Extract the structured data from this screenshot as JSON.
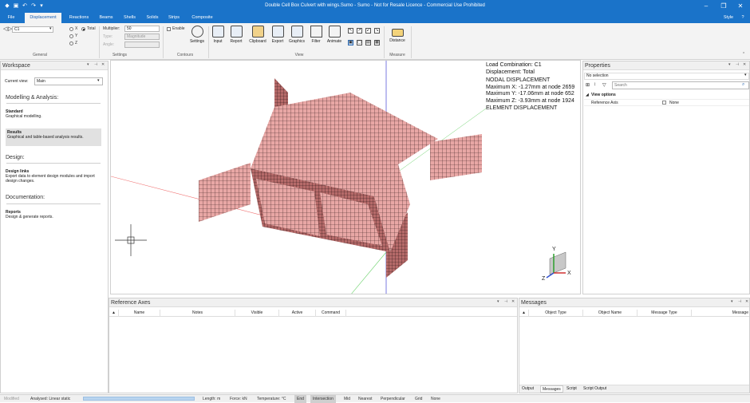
{
  "titlebar": {
    "title": "Double Cell Box Culvert with wings.Sumo - Sumo - Not for Resale Licence - Commercial Use Prohibited"
  },
  "tabs": [
    "File",
    "Displacement",
    "Reactions",
    "Beams",
    "Shells",
    "Solids",
    "Strips",
    "Composite"
  ],
  "style_label": "Style",
  "ribbon": {
    "general": {
      "load_value": "C1",
      "radios": [
        "X",
        "Y",
        "Z"
      ],
      "total_label": "Total",
      "label": "General"
    },
    "settings": {
      "multiplier_label": "Multiplier:",
      "multiplier_value": "50",
      "type_label": "Type:",
      "type_value": "Magnitude",
      "angle_label": "Angle:",
      "label": "Settings"
    },
    "contours": {
      "enable_label": "Enable",
      "settings_label": "Settings",
      "label": "Contours"
    },
    "view": {
      "buttons": [
        "Input",
        "Report",
        "Clipboard",
        "Export",
        "Graphics",
        "Filter",
        "Animate"
      ],
      "label": "View"
    },
    "measure": {
      "distance_label": "Distance",
      "label": "Measure"
    }
  },
  "workspace": {
    "title": "Workspace",
    "current_view_label": "Current view:",
    "current_view_value": "Main",
    "sections": [
      {
        "heading": "Modelling & Analysis:"
      },
      {
        "heading": "Design:"
      },
      {
        "heading": "Documentation:"
      }
    ],
    "items": [
      {
        "title": "Standard",
        "desc": "Graphical modelling."
      },
      {
        "title": "Results",
        "desc": "Graphical and table-based analysis results."
      },
      {
        "title": "Design links",
        "desc": "Export data to element design modules and import design changes."
      },
      {
        "title": "Reports",
        "desc": "Design & generate reports."
      }
    ]
  },
  "viewport": {
    "lines": [
      "Load Combination: C1",
      "Displacement: Total",
      "NODAL DISPLACEMENT",
      "Maximum X: -1.27mm at node 2659",
      "Maximum Y: -17.06mm at node 652",
      "Maximum Z: -3.93mm at node 1924",
      "ELEMENT DISPLACEMENT"
    ],
    "axis_labels": {
      "y": "Y",
      "z": "Z",
      "x": "X"
    },
    "mesh_color": "#e8a7a5",
    "mesh_line_color": "#3a2020"
  },
  "properties": {
    "title": "Properties",
    "selection": "No selection",
    "search_placeholder": "Search",
    "group": "View options",
    "row_name": "Reference Axis",
    "row_value": "None"
  },
  "reference_axes": {
    "title": "Reference Axes",
    "columns": [
      "Name",
      "Notes",
      "Visible",
      "Active",
      "Command"
    ]
  },
  "messages": {
    "title": "Messages",
    "columns": [
      "Object Type",
      "Object Name",
      "Message Type",
      "Message"
    ],
    "tabs": [
      "Output",
      "Messages",
      "Script",
      "Script Output"
    ]
  },
  "status": {
    "modified": "Modified",
    "analysed": "Analysed: Linear static",
    "length": "Length: m",
    "force": "Force: kN",
    "temperature": "Temperature: °C",
    "snaps": [
      "End",
      "Intersection",
      "Mid",
      "Nearest",
      "Perpendicular",
      "Grid",
      "None"
    ]
  }
}
